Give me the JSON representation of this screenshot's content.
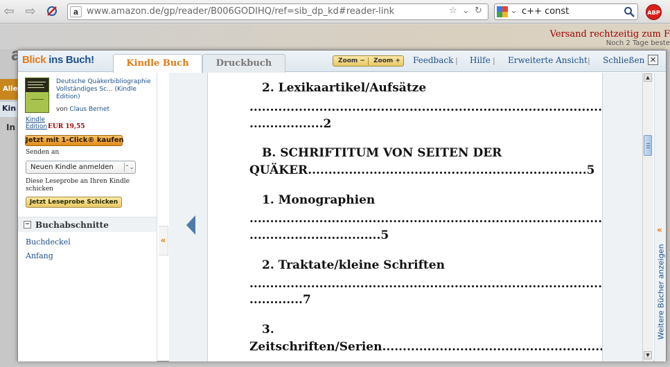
{
  "browser": {
    "url": "www.amazon.de/gp/reader/B006GODIHQ/ref=sib_dp_kd#reader-link",
    "favicon": "a",
    "search_query": "c++ const",
    "adblock_label": "ABP"
  },
  "background_page": {
    "shipping_red": "Versand rechtzeitig zum F",
    "shipping_gray": "Noch 2 Tage beste",
    "logo_fragment": "amazon",
    "tab_fragment": "Alle",
    "kindle_fragment": "Kin",
    "in_fragment": "In"
  },
  "modal": {
    "brand_part1": "Blick",
    "brand_part2": "ins Buch!",
    "tab_kindle": "Kindle Buch",
    "tab_print": "Druckbuch",
    "zoom_out": "Zoom −",
    "zoom_in": "Zoom +",
    "links": {
      "feedback": "Feedback",
      "help": "Hilfe",
      "extended": "Erweiterte Ansicht",
      "close": "Schließen"
    },
    "separator": "|",
    "close_glyph": "✕"
  },
  "book": {
    "title": "Deutsche Quäkerbibliographie Vollständiges Sc... (Kindle Edition)",
    "author_prefix": "von",
    "author": "Claus Bernet",
    "edition": "Kindle Edition",
    "price": "EUR 19,55",
    "buy_button": "Jetzt mit 1-Click® kaufen",
    "send_to": "Senden an",
    "device_select": "Neuen Kindle anmelden",
    "sample_note": "Diese Leseprobe an Ihren Kindle schicken",
    "sample_button": "Jetzt Leseprobe Schicken"
  },
  "sections": {
    "title": "Buchabschnitte",
    "items": [
      "Buchdeckel",
      "Anfang"
    ]
  },
  "page_lines": [
    "2. Lexikaartikel/Aufsätze",
    "..........................................................................................",
    "..................2",
    "B. SCHRIFTITUM VON SEITEN DER",
    "QUÄKER....................................................................5",
    "1. Monographien",
    "..........................................................................................",
    "................................5",
    "2. Traktate/kleine Schriften",
    "..........................................................................................",
    ".............7",
    "3.",
    "Zeitschriften/Serien............................................................"
  ],
  "side_strip": {
    "label": "Weitere Bücher anzeigen",
    "arrow": "«"
  },
  "colors": {
    "accent_orange": "#e47911",
    "link_blue": "#1d4f8a",
    "price_red": "#990000"
  }
}
